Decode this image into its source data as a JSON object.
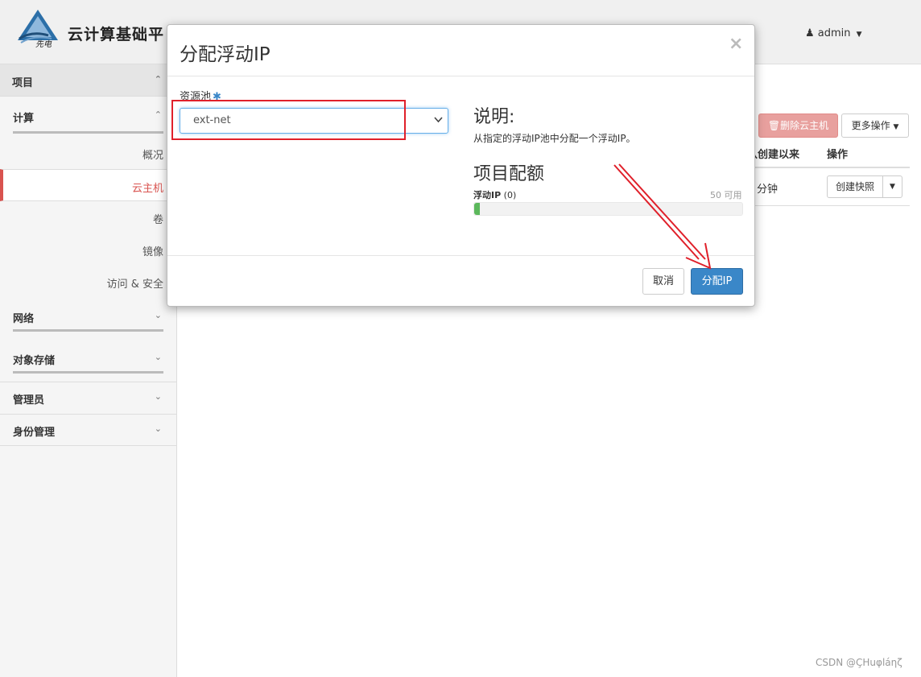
{
  "header": {
    "brand": "云计算基础平",
    "user": "admin"
  },
  "sidebar": {
    "project": "项目",
    "compute": "计算",
    "compute_items": [
      "概况",
      "云主机",
      "卷",
      "镜像",
      "访问 & 安全"
    ],
    "network": "网络",
    "object_storage": "对象存储",
    "admin": "管理员",
    "identity": "身份管理"
  },
  "main": {
    "delete_button": "删除云主机",
    "more_button": "更多操作",
    "col_since_created": "从创建以来",
    "col_actions": "操作",
    "row_time": "分钟",
    "snapshot_button": "创建快照"
  },
  "modal": {
    "title": "分配浮动IP",
    "close": "×",
    "pool_label": "资源池",
    "required_mark": "✱",
    "pool_value": "ext-net",
    "desc_heading": "说明:",
    "desc_text": "从指定的浮动IP池中分配一个浮动IP。",
    "quota_heading": "项目配额",
    "quota_label_name": "浮动IP",
    "quota_label_count": "(0)",
    "quota_available": "50 可用",
    "quota_fill_percent": 2,
    "cancel_button": "取消",
    "allocate_button": "分配IP"
  },
  "colors": {
    "accent_red": "#d9534f",
    "primary_blue": "#3a87c8",
    "highlight_red": "#e0202a",
    "progress_green": "#5cb85c"
  },
  "watermark": "CSDN @ÇHuφláηζ"
}
